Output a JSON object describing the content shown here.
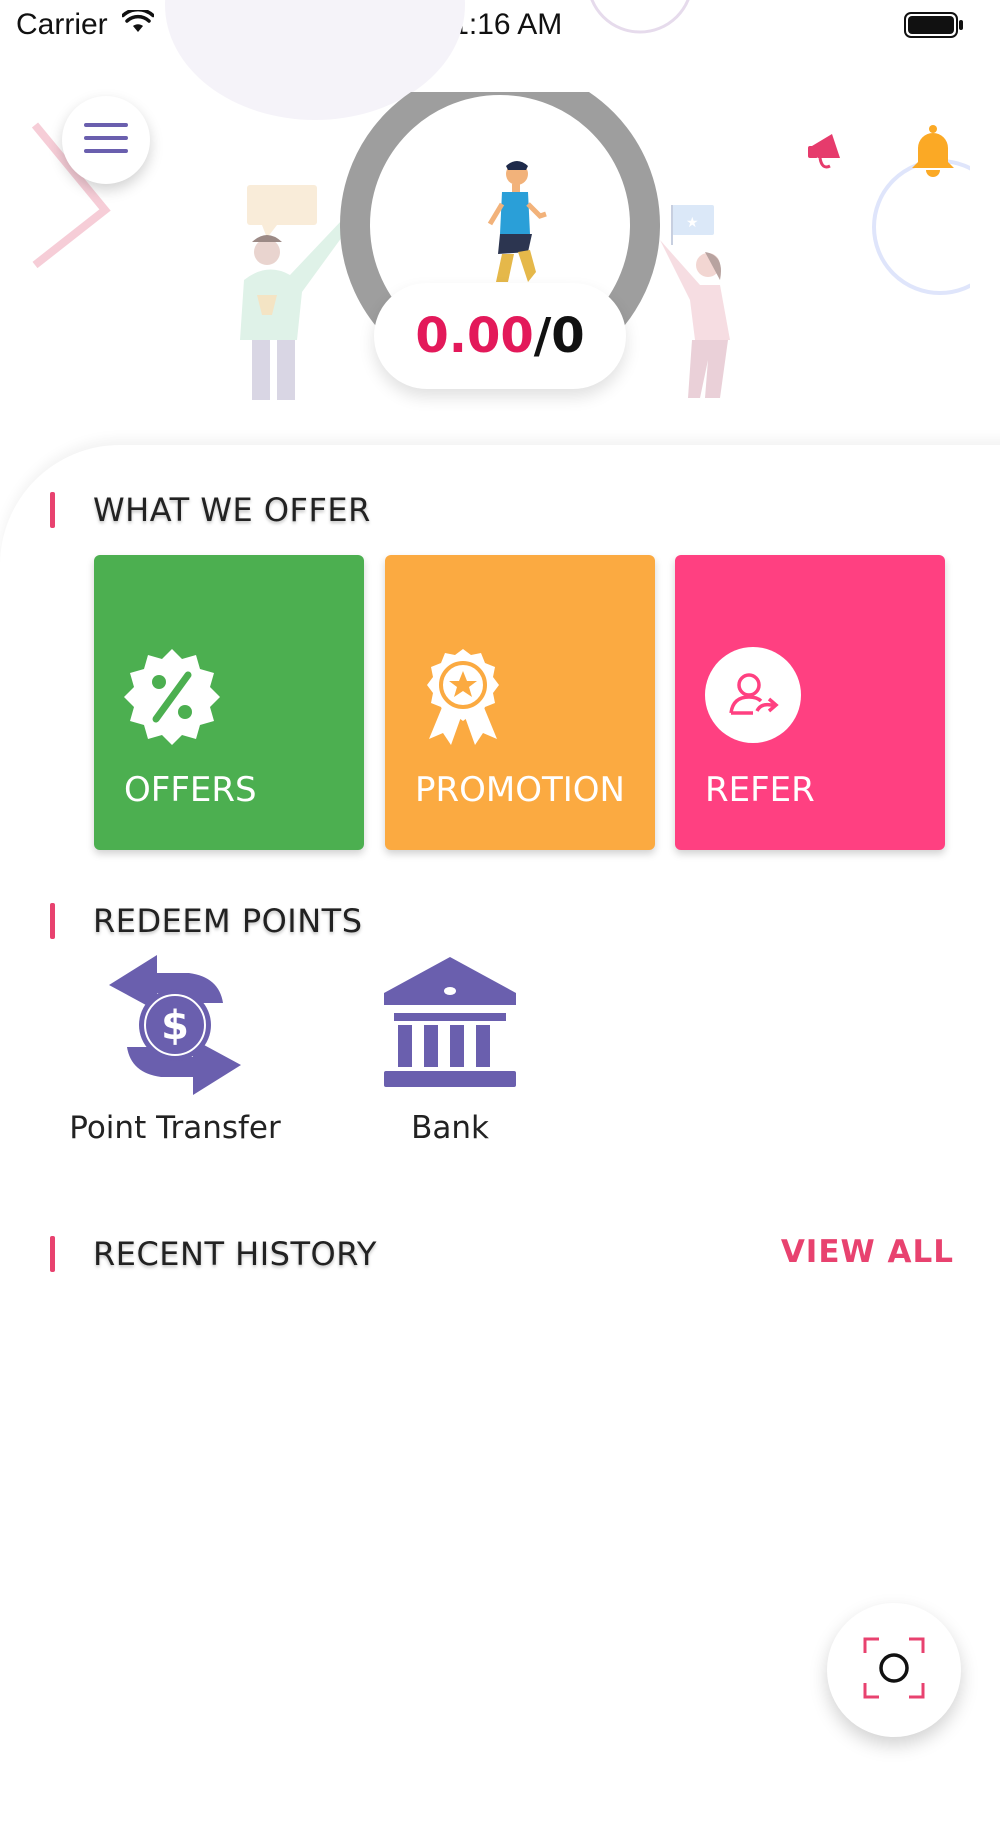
{
  "status_bar": {
    "carrier": "Carrier",
    "time": "11:16 AM"
  },
  "header": {
    "menu_icon": "hamburger-menu-icon",
    "score_value": "0.00",
    "score_total": "/0",
    "announcement_icon": "megaphone-icon",
    "notification_icon": "bell-icon"
  },
  "offers_section": {
    "title": "WHAT WE OFFER",
    "cards": [
      {
        "label": "OFFERS",
        "icon": "discount-badge-icon",
        "color": "#4caf50"
      },
      {
        "label": "PROMOTION",
        "icon": "award-ribbon-icon",
        "color": "#fbaa41"
      },
      {
        "label": "REFER",
        "icon": "refer-user-icon",
        "color": "#ff4081"
      }
    ]
  },
  "redeem_section": {
    "title": "REDEEM POINTS",
    "items": [
      {
        "label": "Point Transfer",
        "icon": "dollar-exchange-icon"
      },
      {
        "label": "Bank",
        "icon": "bank-building-icon"
      }
    ]
  },
  "history_section": {
    "title": "RECENT HISTORY",
    "view_all": "VIEW ALL"
  },
  "fab": {
    "icon": "scan-icon"
  },
  "colors": {
    "accent_pink": "#e8426f",
    "score_red": "#e3195a",
    "icon_purple": "#6a5fae",
    "bell_orange": "#fba925"
  }
}
